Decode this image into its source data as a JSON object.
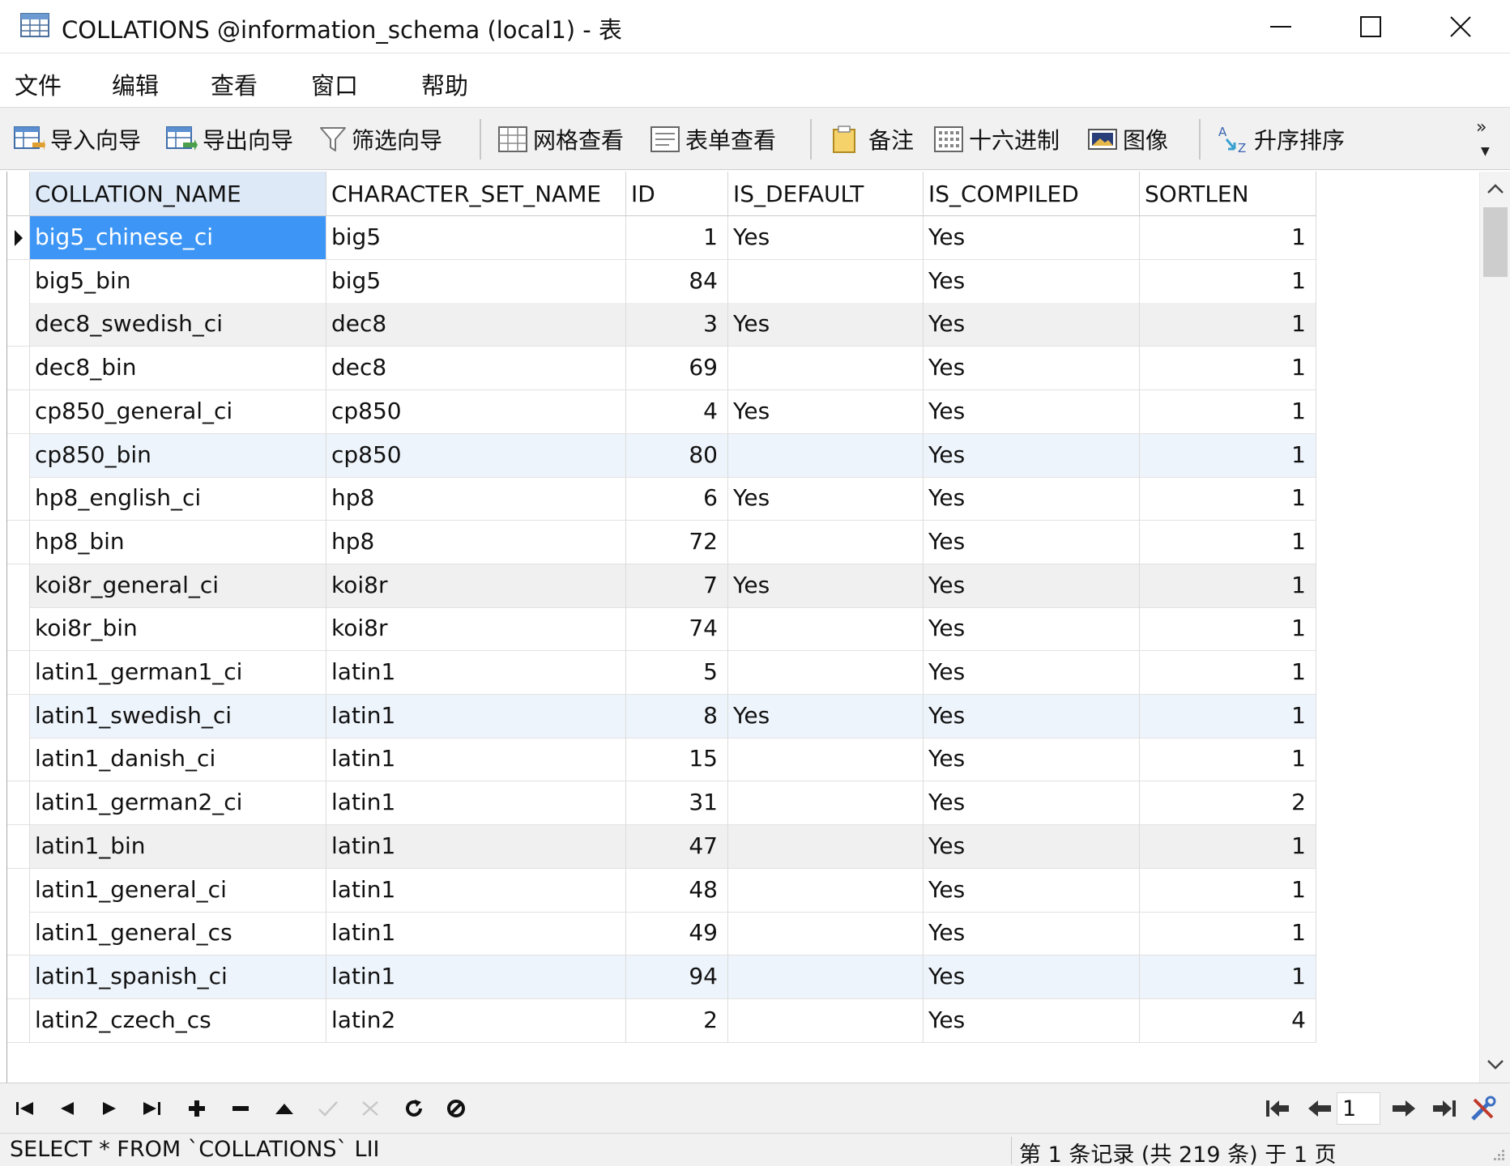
{
  "window": {
    "title": "COLLATIONS @information_schema (local1) - 表"
  },
  "menu": [
    "文件",
    "编辑",
    "查看",
    "窗口",
    "帮助"
  ],
  "toolbar": {
    "import_wizard": "导入向导",
    "export_wizard": "导出向导",
    "filter_wizard": "筛选向导",
    "grid_view": "网格查看",
    "form_view": "表单查看",
    "memo": "备注",
    "hex": "十六进制",
    "image": "图像",
    "sort_asc": "升序排序",
    "more": "»"
  },
  "grid": {
    "columns": [
      "COLLATION_NAME",
      "CHARACTER_SET_NAME",
      "ID",
      "IS_DEFAULT",
      "IS_COMPILED",
      "SORTLEN"
    ],
    "rows": [
      [
        "big5_chinese_ci",
        "big5",
        "1",
        "Yes",
        "Yes",
        "1"
      ],
      [
        "big5_bin",
        "big5",
        "84",
        "",
        "Yes",
        "1"
      ],
      [
        "dec8_swedish_ci",
        "dec8",
        "3",
        "Yes",
        "Yes",
        "1"
      ],
      [
        "dec8_bin",
        "dec8",
        "69",
        "",
        "Yes",
        "1"
      ],
      [
        "cp850_general_ci",
        "cp850",
        "4",
        "Yes",
        "Yes",
        "1"
      ],
      [
        "cp850_bin",
        "cp850",
        "80",
        "",
        "Yes",
        "1"
      ],
      [
        "hp8_english_ci",
        "hp8",
        "6",
        "Yes",
        "Yes",
        "1"
      ],
      [
        "hp8_bin",
        "hp8",
        "72",
        "",
        "Yes",
        "1"
      ],
      [
        "koi8r_general_ci",
        "koi8r",
        "7",
        "Yes",
        "Yes",
        "1"
      ],
      [
        "koi8r_bin",
        "koi8r",
        "74",
        "",
        "Yes",
        "1"
      ],
      [
        "latin1_german1_ci",
        "latin1",
        "5",
        "",
        "Yes",
        "1"
      ],
      [
        "latin1_swedish_ci",
        "latin1",
        "8",
        "Yes",
        "Yes",
        "1"
      ],
      [
        "latin1_danish_ci",
        "latin1",
        "15",
        "",
        "Yes",
        "1"
      ],
      [
        "latin1_german2_ci",
        "latin1",
        "31",
        "",
        "Yes",
        "2"
      ],
      [
        "latin1_bin",
        "latin1",
        "47",
        "",
        "Yes",
        "1"
      ],
      [
        "latin1_general_ci",
        "latin1",
        "48",
        "",
        "Yes",
        "1"
      ],
      [
        "latin1_general_cs",
        "latin1",
        "49",
        "",
        "Yes",
        "1"
      ],
      [
        "latin1_spanish_ci",
        "latin1",
        "94",
        "",
        "Yes",
        "1"
      ],
      [
        "latin2_czech_cs",
        "latin2",
        "2",
        "",
        "Yes",
        "4"
      ]
    ]
  },
  "navigation": {
    "page": "1"
  },
  "status": {
    "sql": "SELECT * FROM `COLLATIONS` LII",
    "record_info": "第 1 条记录 (共 219 条) 于 1 页"
  },
  "colors": {
    "selection": "#3d96f5",
    "header_selected": "#dde9f7",
    "row_alt": "#f0f0f0",
    "toolbar_bg": "#f1f1f1"
  }
}
